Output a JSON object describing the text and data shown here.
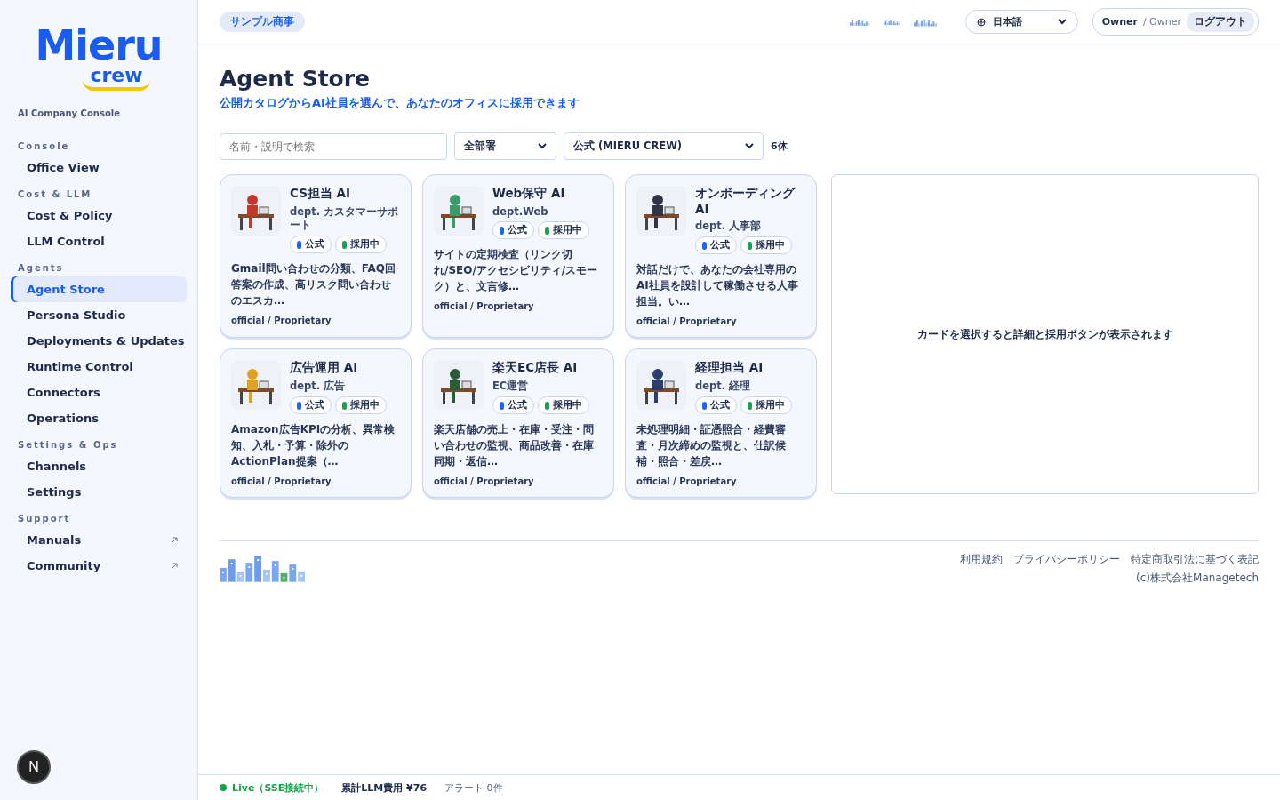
{
  "logo": {
    "line_1": "Mieru",
    "line_2": "crew"
  },
  "sidebar": {
    "subtitle": "AI Company Console",
    "sections": [
      {
        "title": "Console",
        "items": [
          {
            "label": "Office View",
            "selected": false,
            "external": false
          }
        ]
      },
      {
        "title": "Cost & LLM",
        "items": [
          {
            "label": "Cost & Policy",
            "selected": false,
            "external": false
          },
          {
            "label": "LLM Control",
            "selected": false,
            "external": false
          }
        ]
      },
      {
        "title": "Agents",
        "items": [
          {
            "label": "Agent Store",
            "selected": true,
            "external": false
          },
          {
            "label": "Persona Studio",
            "selected": false,
            "external": false
          },
          {
            "label": "Deployments & Updates",
            "selected": false,
            "external": false
          },
          {
            "label": "Runtime Control",
            "selected": false,
            "external": false
          },
          {
            "label": "Connectors",
            "selected": false,
            "external": false
          },
          {
            "label": "Operations",
            "selected": false,
            "external": false
          }
        ]
      },
      {
        "title": "Settings & Ops",
        "items": [
          {
            "label": "Channels",
            "selected": false,
            "external": false
          },
          {
            "label": "Settings",
            "selected": false,
            "external": false
          }
        ]
      },
      {
        "title": "Support",
        "items": [
          {
            "label": "Manuals",
            "selected": false,
            "external": true
          },
          {
            "label": "Community",
            "selected": false,
            "external": true
          }
        ]
      }
    ],
    "dev_button": "N"
  },
  "header": {
    "company": "サンプル商事",
    "language": "日本語",
    "user": "Owner",
    "role": "/ Owner",
    "logout": "ログアウト"
  },
  "page": {
    "title": "Agent Store",
    "subtitle": "公開カタログからAI社員を選んで、あなたのオフィスに採用できます"
  },
  "filters": {
    "search_placeholder": "名前・説明で検索",
    "department": "全部署",
    "source": "公式 (MIERU CREW)",
    "count": "6体"
  },
  "agents": [
    {
      "name": "CS担当 AI",
      "dept": "dept. カスタマーサポート",
      "badge_official": "公式",
      "badge_status": "採用中",
      "description": "Gmail問い合わせの分類、FAQ回答案の作成、高リスク問い合わせのエスカ…",
      "license": "official / Proprietary",
      "color": "#c0392b"
    },
    {
      "name": "Web保守 AI",
      "dept": "dept.Web",
      "badge_official": "公式",
      "badge_status": "採用中",
      "description": "サイトの定期検査（リンク切れ/SEO/アクセシビリティ/スモーク）と、文言修…",
      "license": "official / Proprietary",
      "color": "#3a9a6a"
    },
    {
      "name": "オンボーディングAI",
      "dept": "dept. 人事部",
      "badge_official": "公式",
      "badge_status": "採用中",
      "description": "対話だけで、あなたの会社専用のAI社員を設計して稼働させる人事担当。い…",
      "license": "official / Proprietary",
      "color": "#333344"
    },
    {
      "name": "広告運用 AI",
      "dept": "dept. 広告",
      "badge_official": "公式",
      "badge_status": "採用中",
      "description": "Amazon広告KPIの分析、異常検知、入札・予算・除外のActionPlan提案（…",
      "license": "official / Proprietary",
      "color": "#e0a020"
    },
    {
      "name": "楽天EC店長 AI",
      "dept": "EC運営",
      "badge_official": "公式",
      "badge_status": "採用中",
      "description": "楽天店舗の売上・在庫・受注・問い合わせの監視、商品改善・在庫同期・返信…",
      "license": "official / Proprietary",
      "color": "#2d5a3a"
    },
    {
      "name": "経理担当 AI",
      "dept": "dept. 経理",
      "badge_official": "公式",
      "badge_status": "採用中",
      "description": "未処理明細・証憑照合・経費審査・月次締めの監視と、仕訳候補・照合・差戻…",
      "license": "official / Proprietary",
      "color": "#2c3e70"
    }
  ],
  "detail_panel": {
    "message": "カードを選択すると詳細と採用ボタンが表示されます"
  },
  "footer": {
    "links": [
      "利用規約",
      "プライバシーポリシー",
      "特定商取引法に基づく表記"
    ],
    "copyright": "(c)株式会社Managetech"
  },
  "status_bar": {
    "live": "Live（SSE接続中）",
    "cost": "累計LLM費用 ¥76",
    "alerts": "アラート 0件"
  }
}
